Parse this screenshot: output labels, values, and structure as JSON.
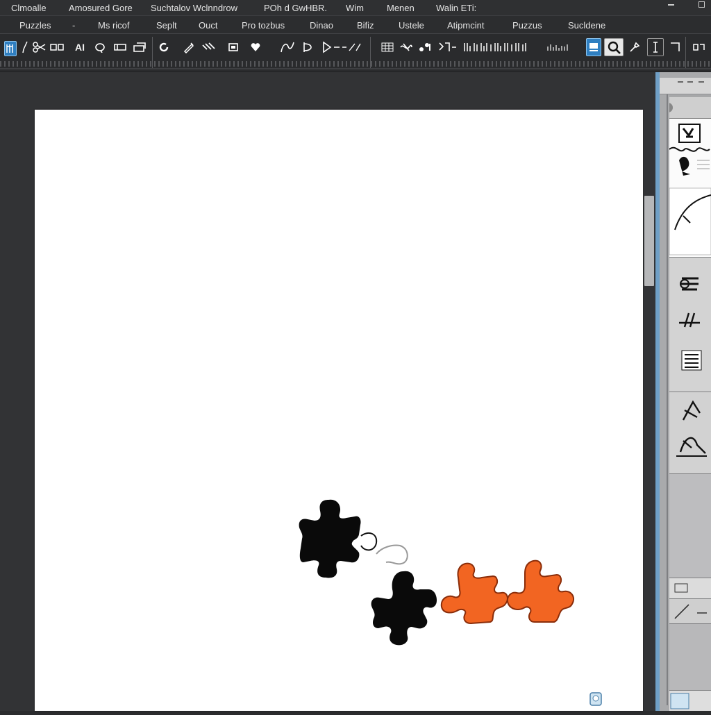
{
  "menu_primary": [
    "Clmoalle",
    "Amosured Gore",
    "Suchtalov Wclnndrow",
    "POh d GwHBR.",
    "Wim",
    "Menen",
    "Walin ETi:"
  ],
  "menu_secondary": [
    "Puzzles",
    "-",
    "Ms ricof",
    "Seplt",
    "Ouct",
    "Pro tozbus",
    "Dinao",
    "Bifiz",
    "Ustele",
    "Atipmcint",
    "Puzzus",
    "Sucldene"
  ],
  "toolbar": {
    "text_tool_label": "A",
    "font_size_label": "AI",
    "pen_label": "ℓ"
  },
  "canvas": {
    "background": "#ffffff",
    "pieces": [
      {
        "name": "puzzle-piece-black-1",
        "color": "#0a0a0a"
      },
      {
        "name": "puzzle-piece-black-2",
        "color": "#0a0a0a"
      },
      {
        "name": "puzzle-piece-orange-1",
        "color": "#f26522"
      },
      {
        "name": "puzzle-piece-orange-2",
        "color": "#f26522"
      }
    ]
  },
  "colors": {
    "accent": "#2f7fc1",
    "piece_orange": "#f26522",
    "piece_outline": "#8a2d0a",
    "chrome_dark": "#2b2c2e"
  },
  "panel": {
    "tab_icons": [
      "layers-icon",
      "brush-icon"
    ]
  }
}
